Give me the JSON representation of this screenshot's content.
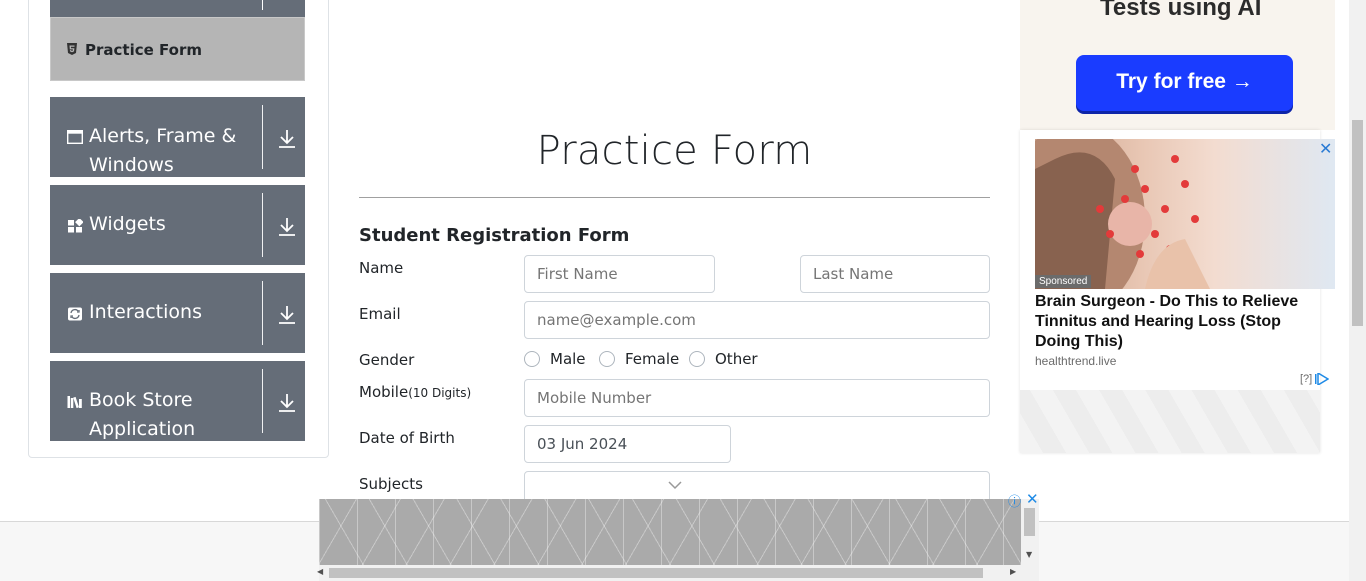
{
  "sidebar": {
    "active_item": {
      "label": "Practice Form",
      "icon": "html5-icon"
    },
    "groups": [
      {
        "label": "Alerts, Frame & Windows",
        "icon": "window-icon"
      },
      {
        "label": "Widgets",
        "icon": "widgets-icon"
      },
      {
        "label": "Interactions",
        "icon": "interactions-icon"
      },
      {
        "label": "Book Store Application",
        "icon": "books-icon"
      }
    ]
  },
  "main": {
    "title": "Practice Form",
    "form_heading": "Student Registration Form",
    "labels": {
      "name": "Name",
      "email": "Email",
      "gender": "Gender",
      "mobile": "Mobile",
      "mobile_hint": "(10 Digits)",
      "dob": "Date of Birth",
      "subjects": "Subjects"
    },
    "placeholders": {
      "first_name": "First Name",
      "last_name": "Last Name",
      "email": "name@example.com",
      "mobile": "Mobile Number"
    },
    "values": {
      "dob": "03 Jun 2024"
    },
    "gender_options": [
      "Male",
      "Female",
      "Other"
    ]
  },
  "right_ad": {
    "headline": "Tests using AI",
    "button": "Try for free →",
    "sponsored": "Sponsored",
    "text": "Brain Surgeon - Do This to Relieve Tinnitus and Hearing Loss (Stop Doing This)",
    "domain": "healthtrend.live",
    "adchoices": "[?]",
    "close": "✕"
  },
  "bottom_ad": {
    "info": "ⓘ",
    "close": "✕"
  },
  "colors": {
    "sidebar_group": "#656d78",
    "sidebar_active": "#b5b5b5",
    "ad_button": "#1a3cff",
    "ad_link": "#1e8ae6"
  }
}
